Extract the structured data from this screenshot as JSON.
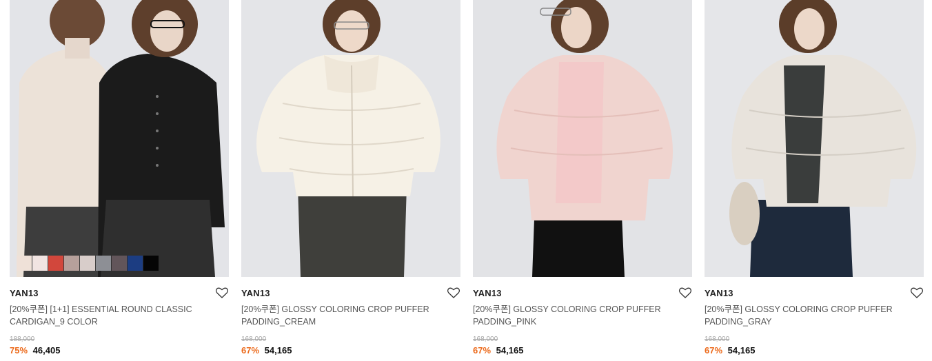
{
  "products": [
    {
      "brand": "YAN13",
      "name": "[20%쿠폰] [1+1] ESSENTIAL ROUND CLASSIC CARDIGAN_9 COLOR",
      "original_price": "188,000",
      "discount": "75%",
      "price": "46,405",
      "swatches": [
        "#efe1d8",
        "#f1e4e2",
        "#d2473c",
        "#b6a09b",
        "#d8cdca",
        "#8d8f95",
        "#62555a",
        "#1c3d82",
        "#050505"
      ]
    },
    {
      "brand": "YAN13",
      "name": "[20%쿠폰] GLOSSY COLORING CROP PUFFER PADDING_CREAM",
      "original_price": "168,000",
      "discount": "67%",
      "price": "54,165"
    },
    {
      "brand": "YAN13",
      "name": "[20%쿠폰] GLOSSY COLORING CROP PUFFER PADDING_PINK",
      "original_price": "168,000",
      "discount": "67%",
      "price": "54,165"
    },
    {
      "brand": "YAN13",
      "name": "[20%쿠폰] GLOSSY COLORING CROP PUFFER PADDING_GRAY",
      "original_price": "168,000",
      "discount": "67%",
      "price": "54,165"
    }
  ],
  "colors": {
    "discount": "#ec6a1b",
    "photo_background": "#e6e7ea"
  },
  "icons": {
    "wishlist": "heart-outline-icon"
  }
}
